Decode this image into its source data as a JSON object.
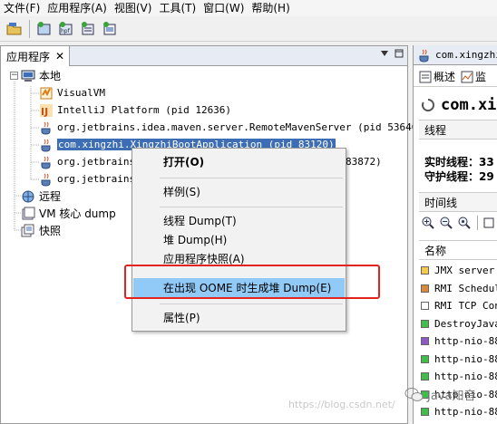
{
  "menubar": {
    "items": [
      "文件(F)",
      "应用程序(A)",
      "视图(V)",
      "工具(T)",
      "窗口(W)",
      "帮助(H)"
    ]
  },
  "left_panel": {
    "tab_label": "应用程序",
    "tree": {
      "local": "本地",
      "local_apps": [
        "VisualVM",
        "IntelliJ Platform (pid 12636)",
        "org.jetbrains.idea.maven.server.RemoteMavenServer (pid 53640)",
        "com.xingzhi.XingzhiBootApplication (pid 83120)",
        "org.jetbrains.",
        "org.jetbrains."
      ],
      "trailing_fragment": "83872)",
      "remote": "远程",
      "vm_core_dump": "VM 核心 dump",
      "snapshots": "快照"
    }
  },
  "context_menu": {
    "items": [
      "打开(O)",
      "样例(S)",
      "线程 Dump(T)",
      "堆 Dump(H)",
      "应用程序快照(A)",
      "在出现 OOME 时生成堆 Dump(E)",
      "属性(P)"
    ]
  },
  "right_panel": {
    "tab_label": "com.xingzhi.",
    "subtabs": [
      "概述",
      "监"
    ],
    "title": "com.xin",
    "threads_header": "线程",
    "live_threads": "实时线程：33",
    "daemon_threads": "守护线程：29",
    "timeline_header": "时间线",
    "name_header": "名称",
    "threads": [
      {
        "name": "JMX server c",
        "color": "#f6c94a"
      },
      {
        "name": "RMI Schedule",
        "color": "#d98b3a"
      },
      {
        "name": "RMI TCP Conn",
        "color": "#ffffff"
      },
      {
        "name": "DestroyJavaV",
        "color": "#3fbf4a"
      },
      {
        "name": "http-nio-888",
        "color": "#8c5ac8"
      },
      {
        "name": "http-nio-888",
        "color": "#3fbf4a"
      },
      {
        "name": "http-nio-888",
        "color": "#3fbf4a"
      },
      {
        "name": "http-nio-888",
        "color": "#3fbf4a"
      },
      {
        "name": "http-nio-888",
        "color": "#3fbf4a"
      },
      {
        "name": "http-nio-888",
        "color": "#3fbf4a"
      }
    ]
  },
  "watermark": {
    "url": "https://blog.csdn.net/",
    "wechat": "Java知音"
  },
  "colors": {
    "selection": "#3d6db5",
    "menu_highlight": "#91c9f7",
    "annotation_red": "#e3231f"
  }
}
